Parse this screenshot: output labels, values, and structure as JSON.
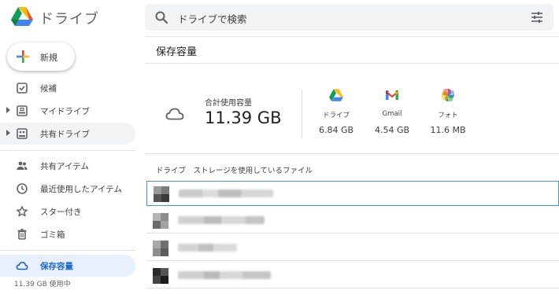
{
  "header": {
    "app_title": "ドライブ",
    "search_placeholder": "ドライブで検索",
    "logo_icon": "google-drive-logo",
    "search_icon": "search-icon",
    "filter_icon": "tune-icon"
  },
  "sidebar": {
    "new_label": "新規",
    "items": [
      {
        "label": "候補",
        "icon": "check-box-icon"
      },
      {
        "label": "マイドライブ",
        "icon": "my-drive-icon"
      },
      {
        "label": "共有ドライブ",
        "icon": "shared-drive-icon"
      },
      {
        "label": "共有アイテム",
        "icon": "people-icon"
      },
      {
        "label": "最近使用したアイテム",
        "icon": "clock-icon"
      },
      {
        "label": "スター付き",
        "icon": "star-icon"
      },
      {
        "label": "ゴミ箱",
        "icon": "trash-icon"
      },
      {
        "label": "保存容量",
        "icon": "cloud-icon"
      }
    ],
    "usage_text": "11.39 GB 使用中"
  },
  "main": {
    "title": "保存容量",
    "total_label": "合計使用容量",
    "total_value": "11.39 GB",
    "services": [
      {
        "name": "ドライブ",
        "size": "6.84 GB",
        "icon": "google-drive-icon"
      },
      {
        "name": "Gmail",
        "size": "4.54 GB",
        "icon": "gmail-icon"
      },
      {
        "name": "フォト",
        "size": "11.6 MB",
        "icon": "google-photos-icon"
      }
    ],
    "files_section_title": "ドライブ　ストレージを使用しているファイル",
    "files_note": "file names are blurred/redacted",
    "files": [
      {
        "selected": true
      },
      {
        "selected": false
      },
      {
        "selected": false
      },
      {
        "selected": false
      }
    ]
  },
  "colors": {
    "accent": "#1967d2",
    "active_bg": "#e8f0fe",
    "search_bg": "#f1f3f4",
    "selected_border": "#4a90e2"
  }
}
